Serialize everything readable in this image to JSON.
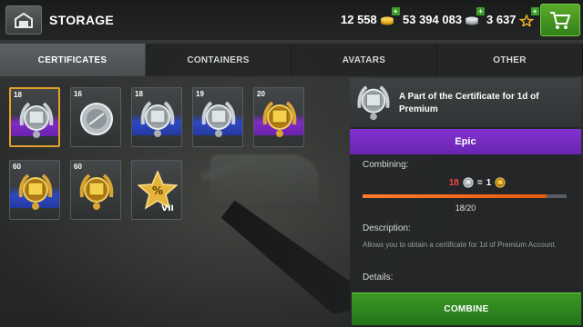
{
  "header": {
    "title": "STORAGE",
    "gold": "12 558",
    "silver": "53 394 083",
    "xp": "3 637",
    "plus": "+"
  },
  "tabs": [
    {
      "label": "CERTIFICATES",
      "active": true
    },
    {
      "label": "CONTAINERS",
      "active": false
    },
    {
      "label": "AVATARS",
      "active": false
    },
    {
      "label": "OTHER",
      "active": false
    }
  ],
  "items": [
    {
      "level": "18",
      "rarity": "epic",
      "icon": "silver-certificate-icon",
      "selected": true
    },
    {
      "level": "16",
      "rarity": "",
      "icon": "silver-disc-icon",
      "selected": false
    },
    {
      "level": "18",
      "rarity": "rare",
      "icon": "silver-certificate-icon",
      "selected": false
    },
    {
      "level": "19",
      "rarity": "rare",
      "icon": "silver-certificate-icon",
      "selected": false
    },
    {
      "level": "20",
      "rarity": "epic",
      "icon": "gold-certificate-icon",
      "selected": false
    },
    {
      "level": "60",
      "rarity": "rare",
      "icon": "gold-certificate-icon",
      "selected": false
    },
    {
      "level": "60",
      "rarity": "",
      "icon": "gold-certificate-icon",
      "selected": false
    },
    {
      "level": "",
      "rarity": "",
      "icon": "gold-star-percent-vii-icon",
      "badge": "VII",
      "selected": false
    }
  ],
  "panel": {
    "name": "A Part of the Certificate for 1d of Premium",
    "rarity": "Epic",
    "combining_label": "Combining:",
    "need": "18",
    "equals": "=",
    "result": "1",
    "progress_value": 0.9,
    "progress_text": "18/20",
    "description_label": "Description:",
    "description": "Allows you to obtain a certificate for 1d of Premium Account.",
    "details_label": "Details:"
  },
  "combine_button": "COMBINE",
  "colors": {
    "epic": "#7e2bc6",
    "rare": "#2e48c4",
    "accent_green": "#3b9a23",
    "selected_border": "#e4a12a",
    "progress": "#ff7b2d"
  }
}
